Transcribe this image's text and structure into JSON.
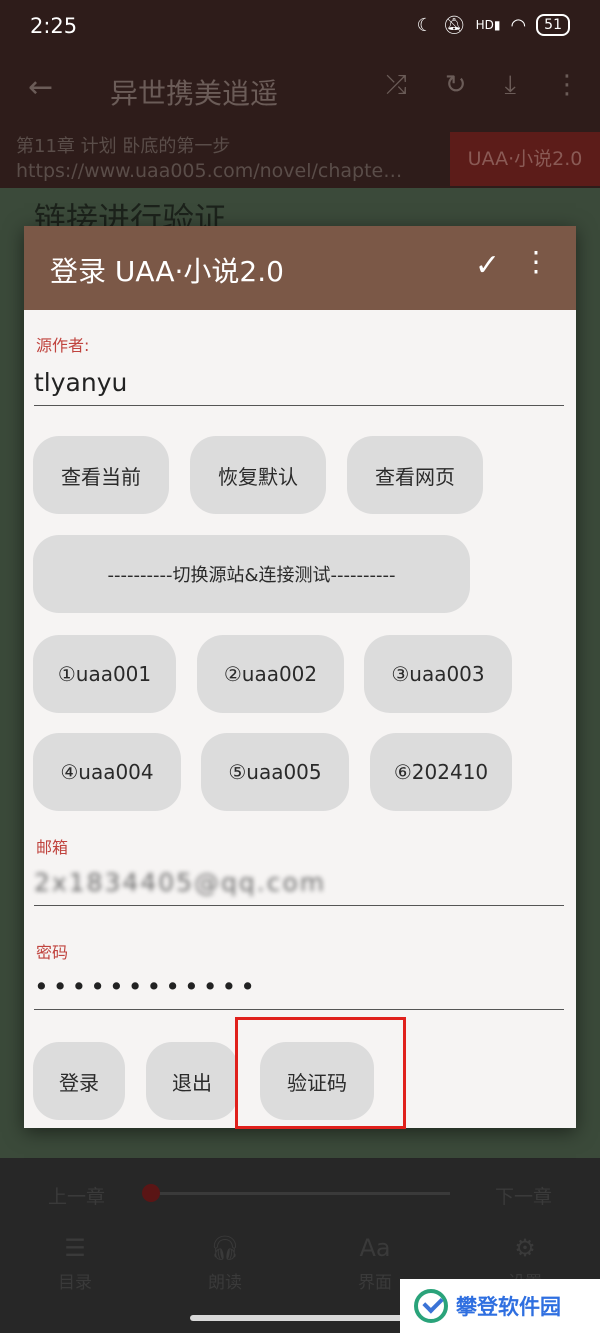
{
  "status_bar": {
    "time": "2:25",
    "hd": "HD",
    "battery": "51"
  },
  "app_bar": {
    "back_icon": "arrow-left-icon",
    "title": "异世携美逍遥",
    "actions": [
      "shuffle-icon",
      "refresh-icon",
      "download-icon",
      "more-vert-icon"
    ]
  },
  "chapter_bar": {
    "chapter": "第11章 计划 卧底的第一步",
    "url": "https://www.uaa005.com/novel/chapte…",
    "source_button": "UAA·小说2.0"
  },
  "reader": {
    "heading": "链接进行验证"
  },
  "dialog": {
    "title": "登录 UAA·小说2.0",
    "author_label": "源作者:",
    "author_value": "tlyanyu",
    "btn_view_current": "查看当前",
    "btn_restore_default": "恢复默认",
    "btn_view_web": "查看网页",
    "btn_switch_source": "----------切换源站&连接测试----------",
    "sites": [
      "①uaa001",
      "②uaa002",
      "③uaa003",
      "④uaa004",
      "⑤uaa005",
      "⑥202410"
    ],
    "email_label": "邮箱",
    "email_value": "2x1834405@qq.com",
    "password_label": "密码",
    "password_value": "••••••••••••",
    "btn_login": "登录",
    "btn_logout": "退出",
    "btn_captcha": "验证码"
  },
  "bottom_bar": {
    "prev": "上一章",
    "next": "下一章",
    "progress": 0,
    "tabs": [
      {
        "icon": "list-icon",
        "label": "目录"
      },
      {
        "icon": "headphones-icon",
        "label": "朗读"
      },
      {
        "icon": "font-icon",
        "label": "界面"
      },
      {
        "icon": "gear-icon",
        "label": "设置"
      }
    ]
  },
  "watermark": {
    "text": "攀登软件园"
  },
  "colors": {
    "dialog_header": "#7b5847",
    "field_label": "#c0433e",
    "highlight_border": "#e0201b"
  }
}
